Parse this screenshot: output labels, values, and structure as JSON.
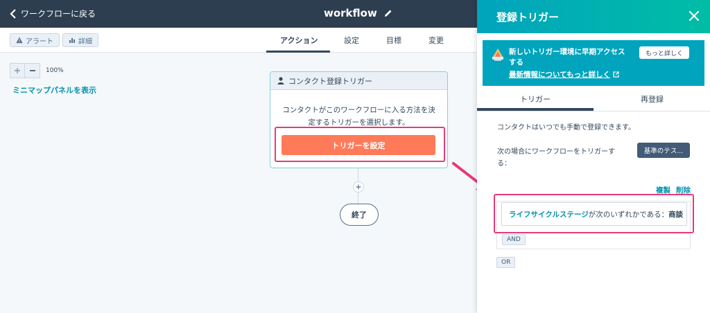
{
  "topbar": {
    "back_label": "ワークフローに戻る",
    "title": "workflow"
  },
  "subbar": {
    "alert_label": "アラート",
    "details_label": "詳細",
    "tabs": [
      {
        "label": "アクション"
      },
      {
        "label": "設定"
      },
      {
        "label": "目標"
      },
      {
        "label": "変更"
      }
    ]
  },
  "canvas": {
    "zoom_level": "100%",
    "minimap_label": "ミニマップパネルを表示",
    "trigger_card": {
      "title": "コンタクト登録トリガー",
      "description_line1": "コンタクトがこのワークフローに入る方法を決",
      "description_line2": "定するトリガーを選択します。",
      "button_label": "トリガーを設定"
    },
    "end_label": "終了"
  },
  "panel": {
    "title": "登録トリガー",
    "banner": {
      "text": "新しいトリガー環境に早期アクセスする",
      "link_label": "最新情報についてもっと詳しく",
      "button_label": "もっと詳しく"
    },
    "tabs": [
      {
        "label": "トリガー"
      },
      {
        "label": "再登録"
      }
    ],
    "manual_text": "コンタクトはいつでも手動で登録できます。",
    "trigger_when_line1": "次の場合にワークフローをトリガーす",
    "trigger_when_line2": "る：",
    "criteria_button": "基準のテス...",
    "clone_label": "複製",
    "delete_label": "削除",
    "filter": {
      "property": "ライフサイクルステージ",
      "operator": "が次のいずれかである：",
      "value": "商談"
    },
    "and_label": "AND",
    "or_label": "OR"
  },
  "colors": {
    "topbar": "#2d3e50",
    "accent_orange": "#ff7a59",
    "teal": "#00a4bd",
    "highlight_pink": "#e6397a",
    "link": "#0091ae"
  }
}
